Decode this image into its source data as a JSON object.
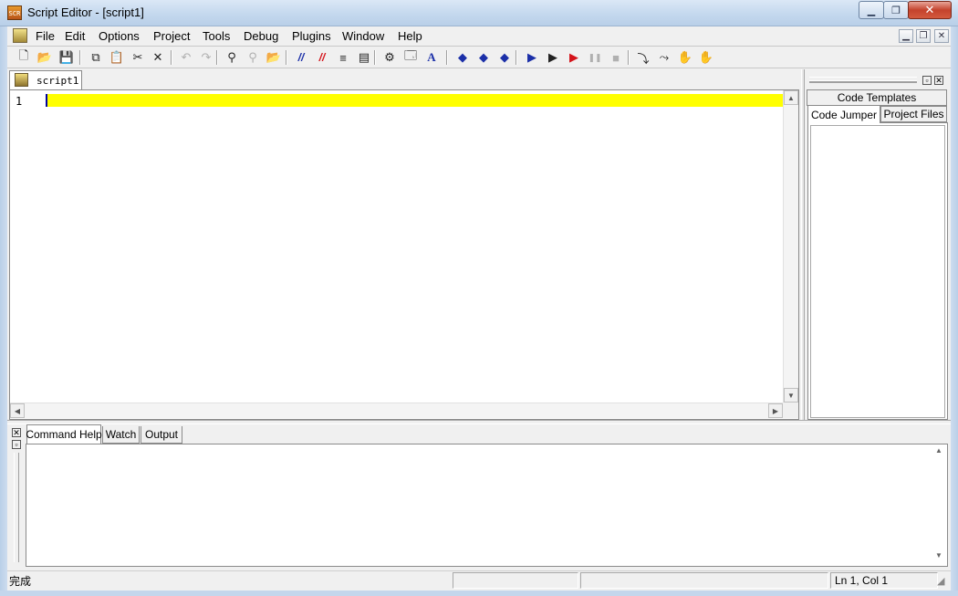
{
  "window": {
    "title": "Script Editor - [script1]",
    "app_icon_text": "SCR"
  },
  "menu": {
    "items": [
      "File",
      "Edit",
      "Options",
      "Project",
      "Tools",
      "Debug",
      "Plugins",
      "Window",
      "Help"
    ]
  },
  "toolbar": {
    "buttons": [
      {
        "name": "new-file-icon",
        "glyph": "🗋",
        "enabled": true
      },
      {
        "name": "open-folder-icon",
        "glyph": "📂",
        "enabled": true
      },
      {
        "name": "save-icon",
        "glyph": "💾",
        "enabled": true
      },
      {
        "name": "copy-icon",
        "glyph": "⧉",
        "enabled": true
      },
      {
        "name": "paste-icon",
        "glyph": "📋",
        "enabled": true
      },
      {
        "name": "cut-icon",
        "glyph": "✂",
        "enabled": true
      },
      {
        "name": "delete-icon",
        "glyph": "✕",
        "enabled": true
      },
      {
        "name": "undo-icon",
        "glyph": "↶",
        "enabled": false
      },
      {
        "name": "redo-icon",
        "glyph": "↷",
        "enabled": false
      },
      {
        "name": "find-icon",
        "glyph": "⚲",
        "enabled": true
      },
      {
        "name": "find-next-icon",
        "glyph": "⚲",
        "enabled": false
      },
      {
        "name": "find-in-files-icon",
        "glyph": "📂",
        "enabled": true
      },
      {
        "name": "comment-icon",
        "glyph": "//",
        "enabled": true
      },
      {
        "name": "uncomment-icon",
        "glyph": "//",
        "enabled": true
      },
      {
        "name": "indent-icon",
        "glyph": "≡",
        "enabled": true
      },
      {
        "name": "bookmark-icon",
        "glyph": "▤",
        "enabled": true
      },
      {
        "name": "settings-gear-icon",
        "glyph": "⚙",
        "enabled": true
      },
      {
        "name": "properties-icon",
        "glyph": "🗔",
        "enabled": true
      },
      {
        "name": "font-icon",
        "glyph": "A",
        "enabled": true
      },
      {
        "name": "breakpoint-icon",
        "glyph": "◆",
        "enabled": true
      },
      {
        "name": "breakpoint-next-icon",
        "glyph": "◆",
        "enabled": true
      },
      {
        "name": "breakpoint-clear-icon",
        "glyph": "◆",
        "enabled": true
      },
      {
        "name": "run-icon",
        "glyph": "▶",
        "enabled": true
      },
      {
        "name": "run-step-icon",
        "glyph": "▶",
        "enabled": true
      },
      {
        "name": "run-debug-icon",
        "glyph": "▶",
        "enabled": true
      },
      {
        "name": "pause-icon",
        "glyph": "❚❚",
        "enabled": false
      },
      {
        "name": "stop-icon",
        "glyph": "■",
        "enabled": false
      },
      {
        "name": "step-into-icon",
        "glyph": "⤵",
        "enabled": true
      },
      {
        "name": "step-over-icon",
        "glyph": "⤳",
        "enabled": true
      },
      {
        "name": "hand-icon",
        "glyph": "✋",
        "enabled": true
      },
      {
        "name": "hand-disabled-icon",
        "glyph": "✋",
        "enabled": false
      }
    ]
  },
  "editor": {
    "tab_label": "script1",
    "line_numbers": [
      "1"
    ],
    "highlight_color": "#ffff00"
  },
  "right_dock": {
    "tabs": [
      "Code Templates",
      "Code Jumper",
      "Project Files"
    ],
    "active_tab": "Code Jumper"
  },
  "bottom_dock": {
    "tabs": [
      "Command Help",
      "Watch",
      "Output"
    ],
    "active_tab": "Command Help"
  },
  "status": {
    "left": "完成",
    "position": "Ln 1, Col 1"
  }
}
